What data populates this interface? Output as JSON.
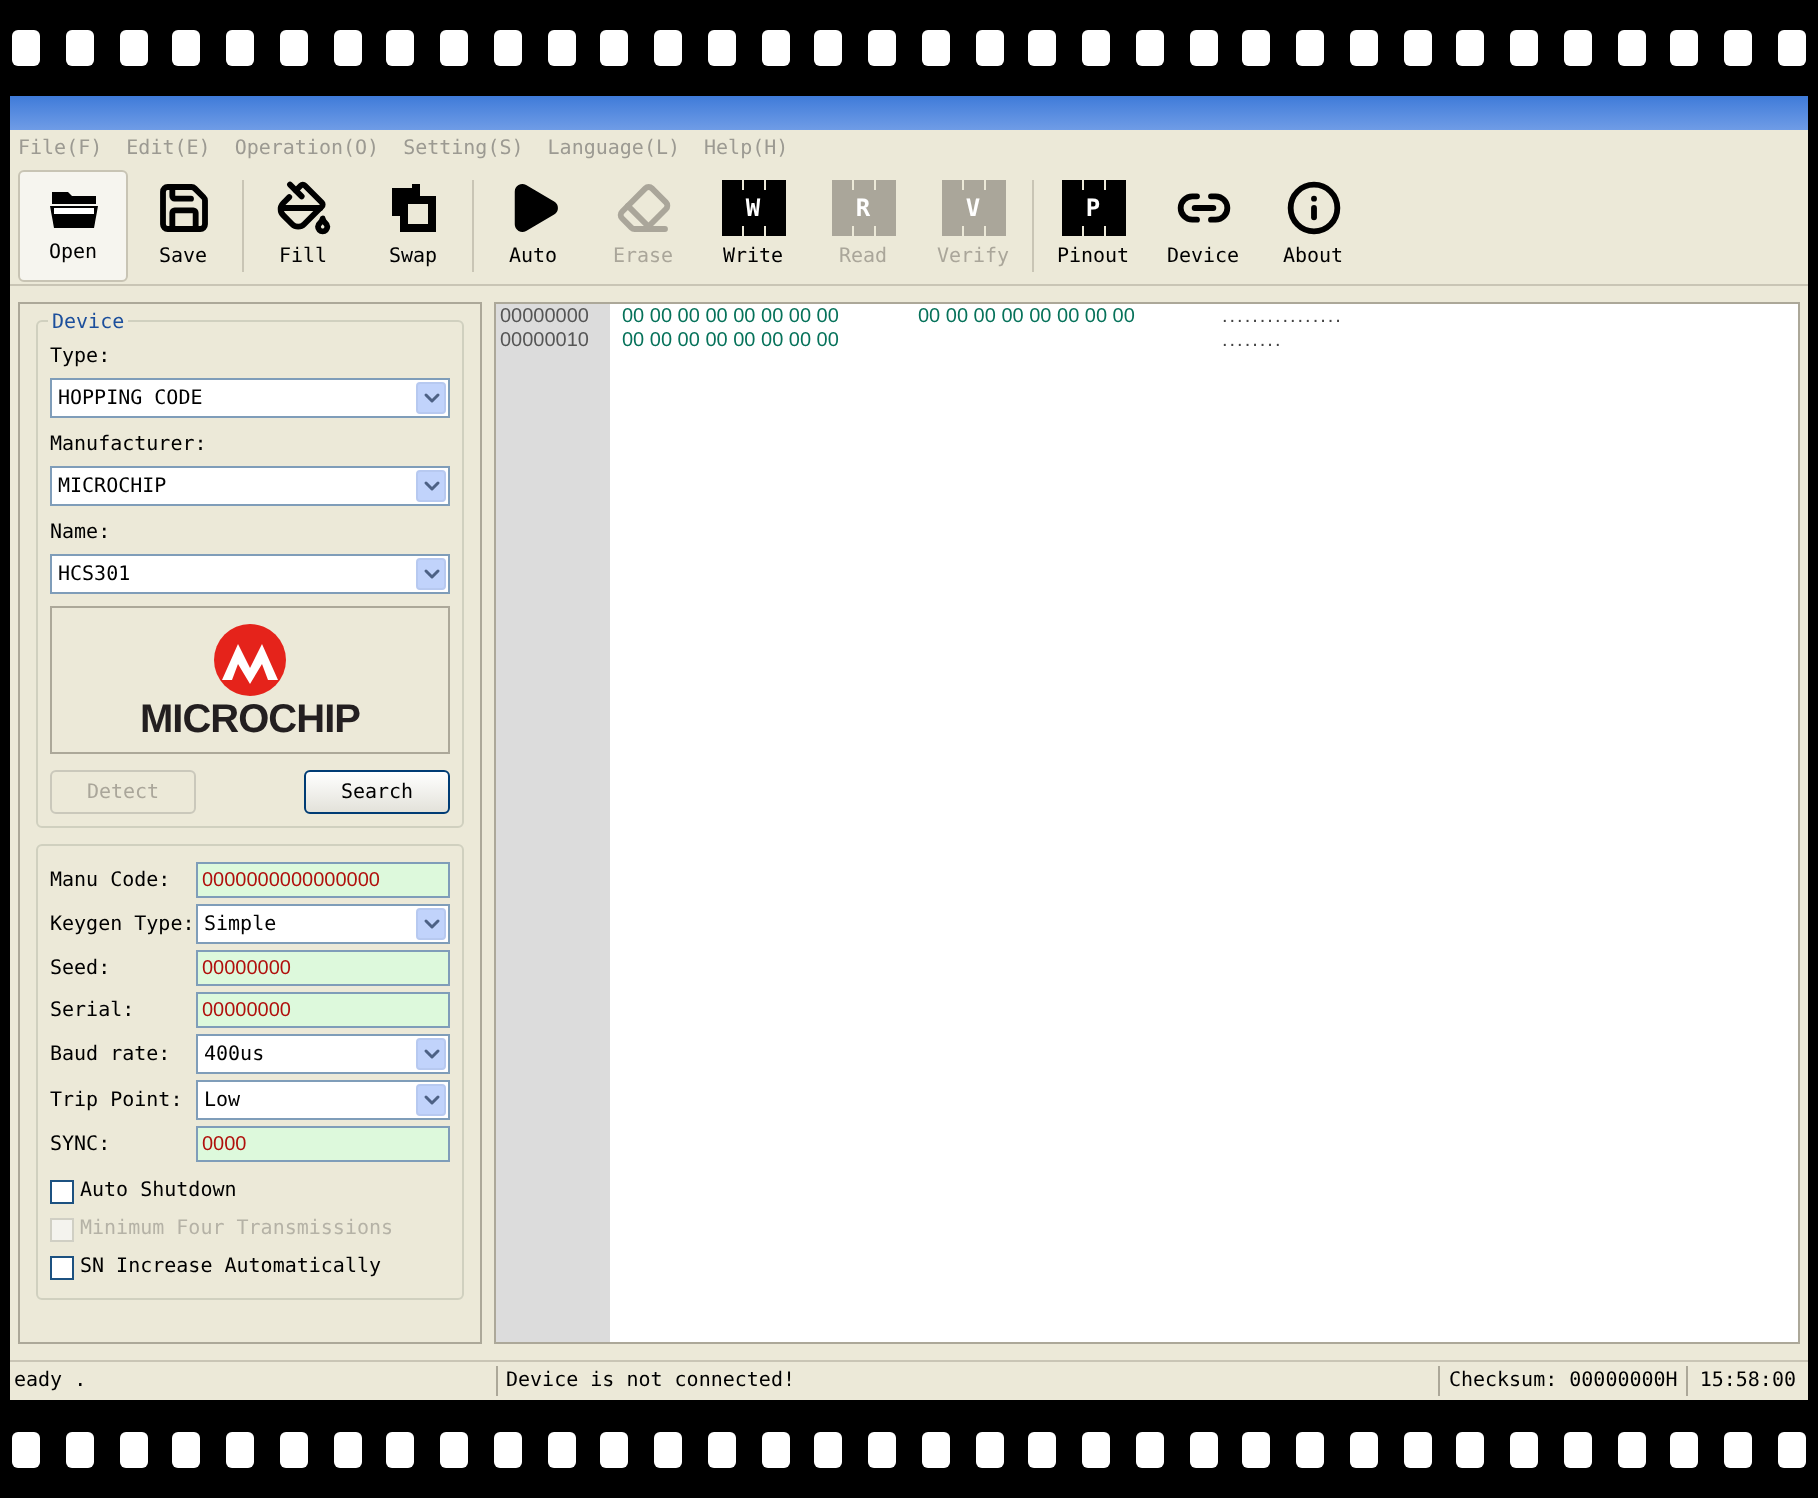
{
  "menu": [
    {
      "label": "File(F)"
    },
    {
      "label": "Edit(E)"
    },
    {
      "label": "Operation(O)"
    },
    {
      "label": "Setting(S)"
    },
    {
      "label": "Language(L)"
    },
    {
      "label": "Help(H)"
    }
  ],
  "toolbar": [
    {
      "kind": "folder",
      "label": "Open",
      "disabled": false,
      "selected": true
    },
    {
      "kind": "floppy",
      "label": "Save",
      "disabled": false,
      "selected": false
    },
    {
      "kind": "separator"
    },
    {
      "kind": "bucket",
      "label": "Fill",
      "disabled": false,
      "selected": false
    },
    {
      "kind": "swap",
      "label": "Swap",
      "disabled": false,
      "selected": false
    },
    {
      "kind": "separator"
    },
    {
      "kind": "play",
      "label": "Auto",
      "disabled": false,
      "selected": false
    },
    {
      "kind": "eraser",
      "label": "Erase",
      "disabled": true,
      "selected": false
    },
    {
      "kind": "chip",
      "chip_letter": "W",
      "label": "Write",
      "disabled": false,
      "selected": false
    },
    {
      "kind": "chip",
      "chip_letter": "R",
      "label": "Read",
      "disabled": true,
      "selected": false
    },
    {
      "kind": "chip",
      "chip_letter": "V",
      "label": "Verify",
      "disabled": true,
      "selected": false
    },
    {
      "kind": "separator"
    },
    {
      "kind": "chip",
      "chip_letter": "P",
      "label": "Pinout",
      "disabled": false,
      "selected": false
    },
    {
      "kind": "link",
      "label": "Device",
      "disabled": false,
      "selected": false
    },
    {
      "kind": "info",
      "label": "About",
      "disabled": false,
      "selected": false
    }
  ],
  "device": {
    "title": "Device",
    "fields": [
      {
        "label": "Type:",
        "value": "HOPPING CODE"
      },
      {
        "label": "Manufacturer:",
        "value": "MICROCHIP"
      },
      {
        "label": "Name:",
        "value": "HCS301"
      }
    ],
    "logo_text": "MICROCHIP",
    "buttons": [
      {
        "label": "Detect",
        "disabled": true
      },
      {
        "label": "Search",
        "disabled": false
      }
    ]
  },
  "settings": {
    "fields": [
      {
        "kind": "text",
        "label": "Manu Code:",
        "value": "0000000000000000"
      },
      {
        "kind": "select",
        "label": "Keygen Type:",
        "value": "Simple"
      },
      {
        "kind": "text",
        "label": "Seed:",
        "value": "00000000"
      },
      {
        "kind": "text",
        "label": "Serial:",
        "value": "00000000"
      },
      {
        "kind": "select",
        "label": "Baud rate:",
        "value": "400us"
      },
      {
        "kind": "select",
        "label": "Trip Point:",
        "value": "Low"
      },
      {
        "kind": "text",
        "label": "SYNC:",
        "value": "0000"
      }
    ],
    "checkboxes": [
      {
        "label": "Auto Shutdown",
        "checked": false,
        "disabled": false
      },
      {
        "label": "Minimum Four Transmissions",
        "checked": false,
        "disabled": true
      },
      {
        "label": "SN Increase Automatically",
        "checked": false,
        "disabled": false
      }
    ]
  },
  "hex": {
    "rows": [
      {
        "address": "00000000",
        "bytes_1": "00 00 00 00 00 00 00 00",
        "bytes_2": "00 00 00 00 00 00 00 00",
        "ascii": "................"
      },
      {
        "address": "00000010",
        "bytes_1": "00 00 00 00 00 00 00 00",
        "ascii": "........"
      }
    ]
  },
  "status_bar": {
    "message": "eady .",
    "connection": "Device is not connected!",
    "checksum": "Checksum: 00000000H",
    "time": "15:58:00"
  }
}
